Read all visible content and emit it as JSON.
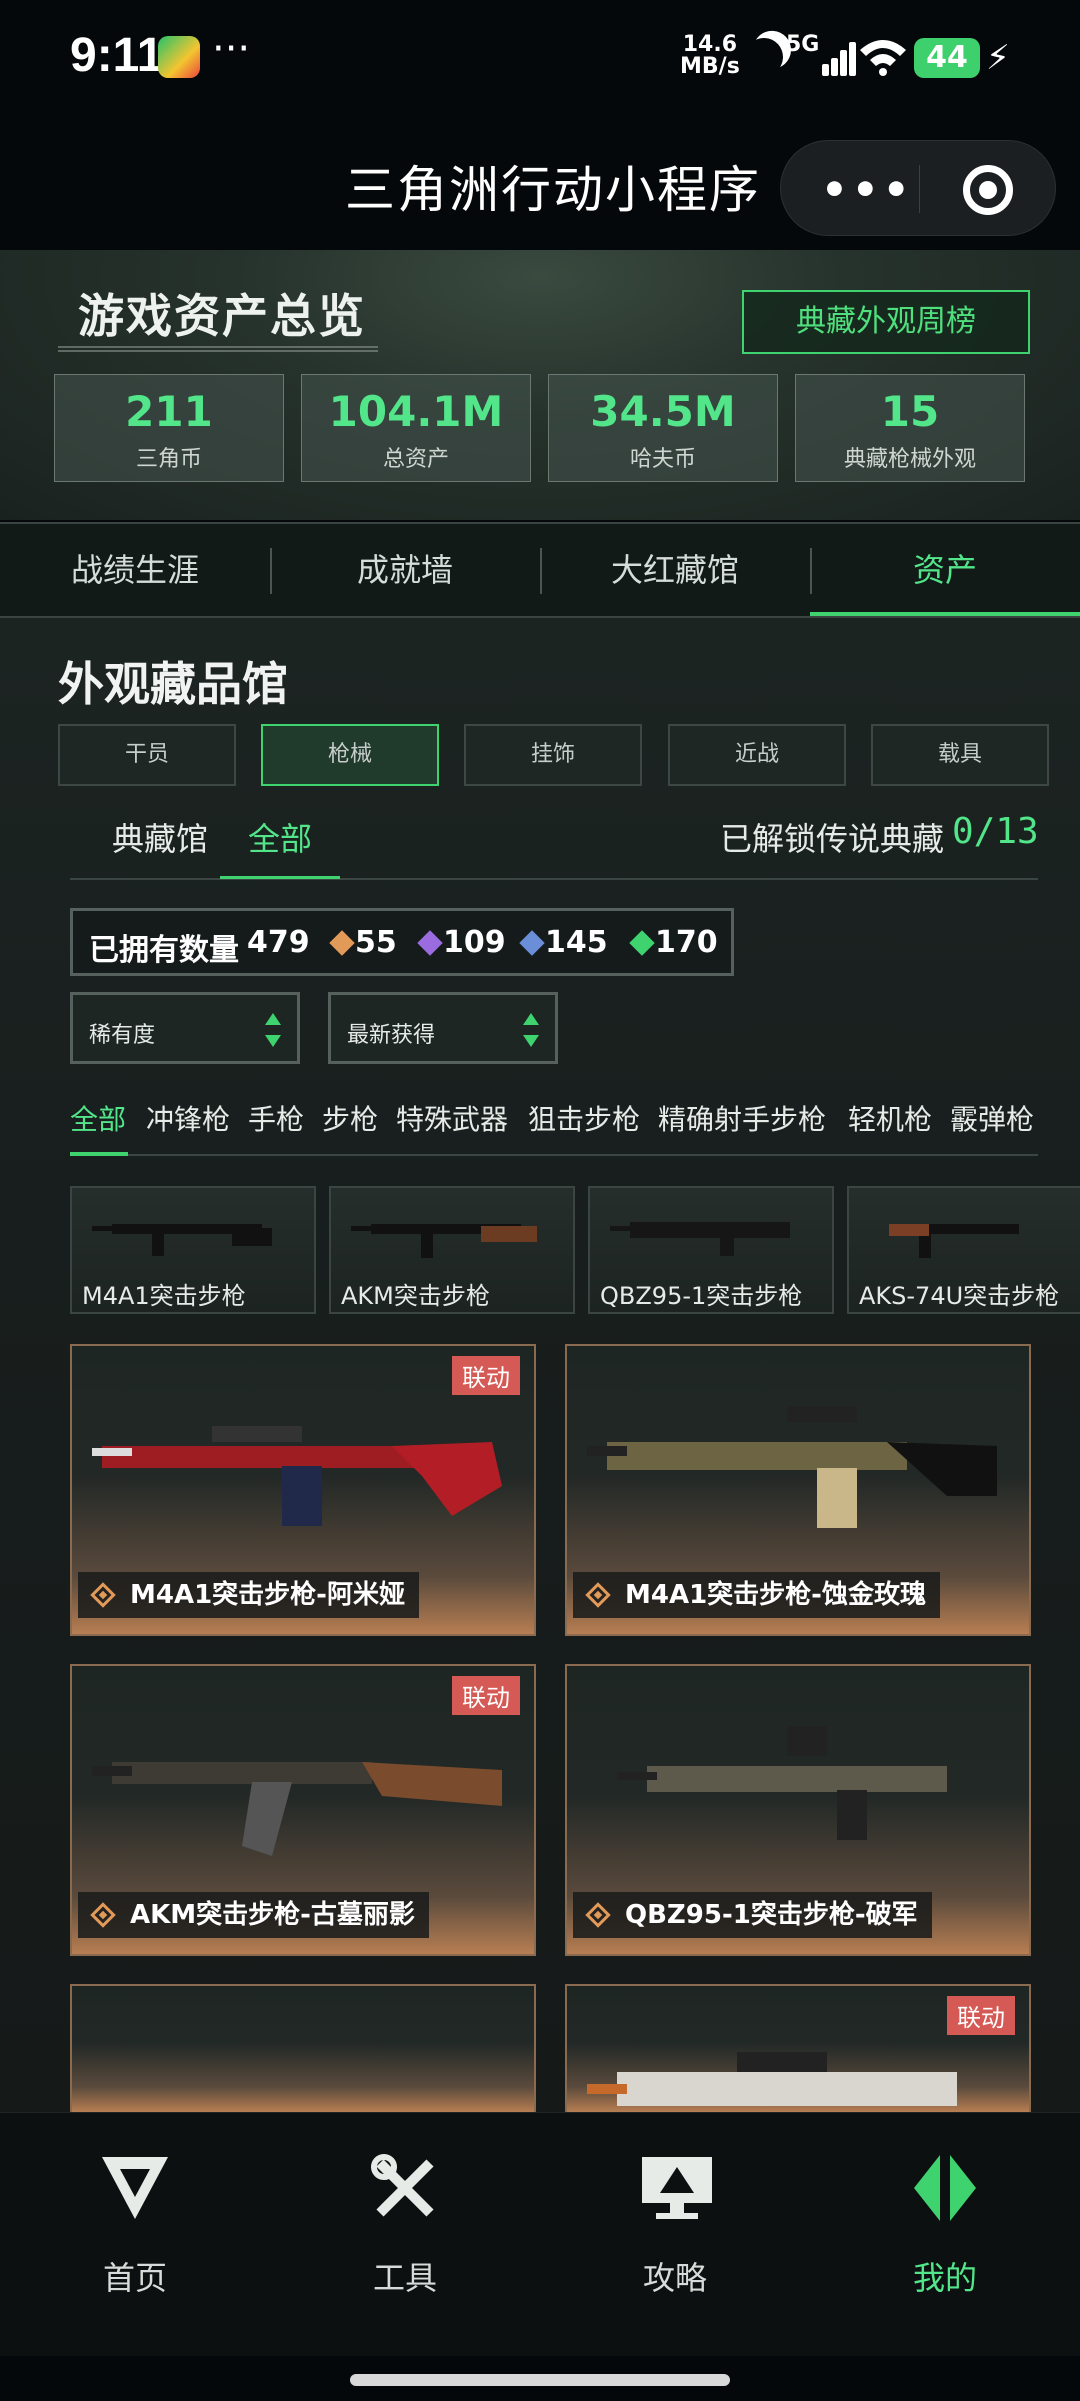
{
  "status": {
    "time": "9:11",
    "dots": "···",
    "speed_top": "14.6",
    "speed_bottom": "MB/s",
    "network": "5G",
    "battery": "44"
  },
  "header": {
    "title": "三角洲行动小程序",
    "more": "•••"
  },
  "hero": {
    "title": "游戏资产总览",
    "weekly_button": "典藏外观周榜",
    "stats": [
      {
        "value": "211",
        "label": "三角币"
      },
      {
        "value": "104.1M",
        "label": "总资产"
      },
      {
        "value": "34.5M",
        "label": "哈夫币"
      },
      {
        "value": "15",
        "label": "典藏枪械外观"
      }
    ]
  },
  "tabs": [
    "战绩生涯",
    "成就墙",
    "大红藏馆",
    "资产"
  ],
  "gallery": {
    "title": "外观藏品馆",
    "categories": [
      "干员",
      "枪械",
      "挂饰",
      "近战",
      "载具"
    ],
    "subtabs": [
      "典藏馆",
      "全部"
    ],
    "unlock_label": "已解锁传说典藏",
    "unlock_value": "0/13",
    "owned_label": "已拥有数量",
    "owned_total": "479",
    "owned_counts": [
      "55",
      "109",
      "145",
      "170"
    ],
    "sort_rarity": "稀有度",
    "sort_recent": "最新获得",
    "weapon_types": [
      "全部",
      "冲锋枪",
      "手枪",
      "步枪",
      "特殊武器",
      "狙击步枪",
      "精确射手步枪",
      "轻机枪",
      "霰弹枪"
    ],
    "thumbs": [
      "M4A1突击步枪",
      "AKM突击步枪",
      "QBZ95-1突击步枪",
      "AKS-74U突击步枪"
    ],
    "collab_tag": "联动",
    "cards": [
      "M4A1突击步枪-阿米娅",
      "M4A1突击步枪-蚀金玫瑰",
      "AKM突击步枪-古墓丽影",
      "QBZ95-1突击步枪-破军"
    ]
  },
  "colors": {
    "accent": "#3fd36f",
    "collab": "#d55a55",
    "rarity_orange": "#e29a59",
    "rarity_purple": "#9b6be0",
    "rarity_blue": "#6a8fd8",
    "rarity_green": "#3fd36f"
  },
  "bottom_nav": [
    "首页",
    "工具",
    "攻略",
    "我的"
  ]
}
